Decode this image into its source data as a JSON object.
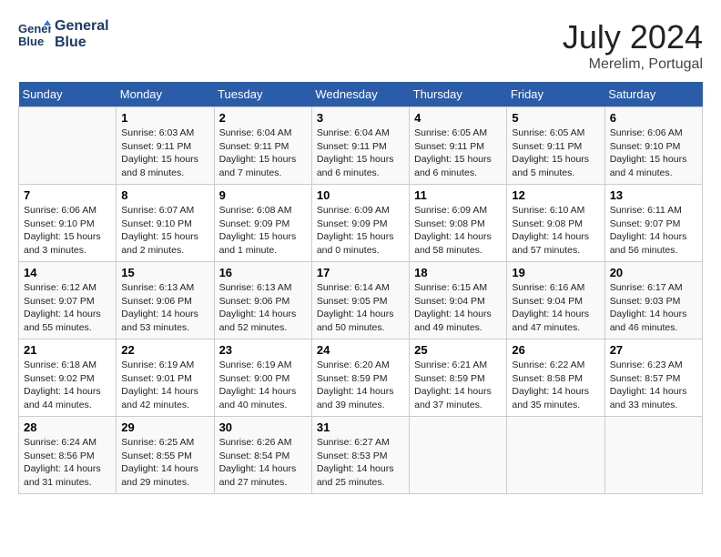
{
  "header": {
    "logo_line1": "General",
    "logo_line2": "Blue",
    "month_year": "July 2024",
    "location": "Merelim, Portugal"
  },
  "days_of_week": [
    "Sunday",
    "Monday",
    "Tuesday",
    "Wednesday",
    "Thursday",
    "Friday",
    "Saturday"
  ],
  "weeks": [
    [
      {
        "day": "",
        "info": ""
      },
      {
        "day": "1",
        "info": "Sunrise: 6:03 AM\nSunset: 9:11 PM\nDaylight: 15 hours\nand 8 minutes."
      },
      {
        "day": "2",
        "info": "Sunrise: 6:04 AM\nSunset: 9:11 PM\nDaylight: 15 hours\nand 7 minutes."
      },
      {
        "day": "3",
        "info": "Sunrise: 6:04 AM\nSunset: 9:11 PM\nDaylight: 15 hours\nand 6 minutes."
      },
      {
        "day": "4",
        "info": "Sunrise: 6:05 AM\nSunset: 9:11 PM\nDaylight: 15 hours\nand 6 minutes."
      },
      {
        "day": "5",
        "info": "Sunrise: 6:05 AM\nSunset: 9:11 PM\nDaylight: 15 hours\nand 5 minutes."
      },
      {
        "day": "6",
        "info": "Sunrise: 6:06 AM\nSunset: 9:10 PM\nDaylight: 15 hours\nand 4 minutes."
      }
    ],
    [
      {
        "day": "7",
        "info": "Sunrise: 6:06 AM\nSunset: 9:10 PM\nDaylight: 15 hours\nand 3 minutes."
      },
      {
        "day": "8",
        "info": "Sunrise: 6:07 AM\nSunset: 9:10 PM\nDaylight: 15 hours\nand 2 minutes."
      },
      {
        "day": "9",
        "info": "Sunrise: 6:08 AM\nSunset: 9:09 PM\nDaylight: 15 hours\nand 1 minute."
      },
      {
        "day": "10",
        "info": "Sunrise: 6:09 AM\nSunset: 9:09 PM\nDaylight: 15 hours\nand 0 minutes."
      },
      {
        "day": "11",
        "info": "Sunrise: 6:09 AM\nSunset: 9:08 PM\nDaylight: 14 hours\nand 58 minutes."
      },
      {
        "day": "12",
        "info": "Sunrise: 6:10 AM\nSunset: 9:08 PM\nDaylight: 14 hours\nand 57 minutes."
      },
      {
        "day": "13",
        "info": "Sunrise: 6:11 AM\nSunset: 9:07 PM\nDaylight: 14 hours\nand 56 minutes."
      }
    ],
    [
      {
        "day": "14",
        "info": "Sunrise: 6:12 AM\nSunset: 9:07 PM\nDaylight: 14 hours\nand 55 minutes."
      },
      {
        "day": "15",
        "info": "Sunrise: 6:13 AM\nSunset: 9:06 PM\nDaylight: 14 hours\nand 53 minutes."
      },
      {
        "day": "16",
        "info": "Sunrise: 6:13 AM\nSunset: 9:06 PM\nDaylight: 14 hours\nand 52 minutes."
      },
      {
        "day": "17",
        "info": "Sunrise: 6:14 AM\nSunset: 9:05 PM\nDaylight: 14 hours\nand 50 minutes."
      },
      {
        "day": "18",
        "info": "Sunrise: 6:15 AM\nSunset: 9:04 PM\nDaylight: 14 hours\nand 49 minutes."
      },
      {
        "day": "19",
        "info": "Sunrise: 6:16 AM\nSunset: 9:04 PM\nDaylight: 14 hours\nand 47 minutes."
      },
      {
        "day": "20",
        "info": "Sunrise: 6:17 AM\nSunset: 9:03 PM\nDaylight: 14 hours\nand 46 minutes."
      }
    ],
    [
      {
        "day": "21",
        "info": "Sunrise: 6:18 AM\nSunset: 9:02 PM\nDaylight: 14 hours\nand 44 minutes."
      },
      {
        "day": "22",
        "info": "Sunrise: 6:19 AM\nSunset: 9:01 PM\nDaylight: 14 hours\nand 42 minutes."
      },
      {
        "day": "23",
        "info": "Sunrise: 6:19 AM\nSunset: 9:00 PM\nDaylight: 14 hours\nand 40 minutes."
      },
      {
        "day": "24",
        "info": "Sunrise: 6:20 AM\nSunset: 8:59 PM\nDaylight: 14 hours\nand 39 minutes."
      },
      {
        "day": "25",
        "info": "Sunrise: 6:21 AM\nSunset: 8:59 PM\nDaylight: 14 hours\nand 37 minutes."
      },
      {
        "day": "26",
        "info": "Sunrise: 6:22 AM\nSunset: 8:58 PM\nDaylight: 14 hours\nand 35 minutes."
      },
      {
        "day": "27",
        "info": "Sunrise: 6:23 AM\nSunset: 8:57 PM\nDaylight: 14 hours\nand 33 minutes."
      }
    ],
    [
      {
        "day": "28",
        "info": "Sunrise: 6:24 AM\nSunset: 8:56 PM\nDaylight: 14 hours\nand 31 minutes."
      },
      {
        "day": "29",
        "info": "Sunrise: 6:25 AM\nSunset: 8:55 PM\nDaylight: 14 hours\nand 29 minutes."
      },
      {
        "day": "30",
        "info": "Sunrise: 6:26 AM\nSunset: 8:54 PM\nDaylight: 14 hours\nand 27 minutes."
      },
      {
        "day": "31",
        "info": "Sunrise: 6:27 AM\nSunset: 8:53 PM\nDaylight: 14 hours\nand 25 minutes."
      },
      {
        "day": "",
        "info": ""
      },
      {
        "day": "",
        "info": ""
      },
      {
        "day": "",
        "info": ""
      }
    ]
  ]
}
